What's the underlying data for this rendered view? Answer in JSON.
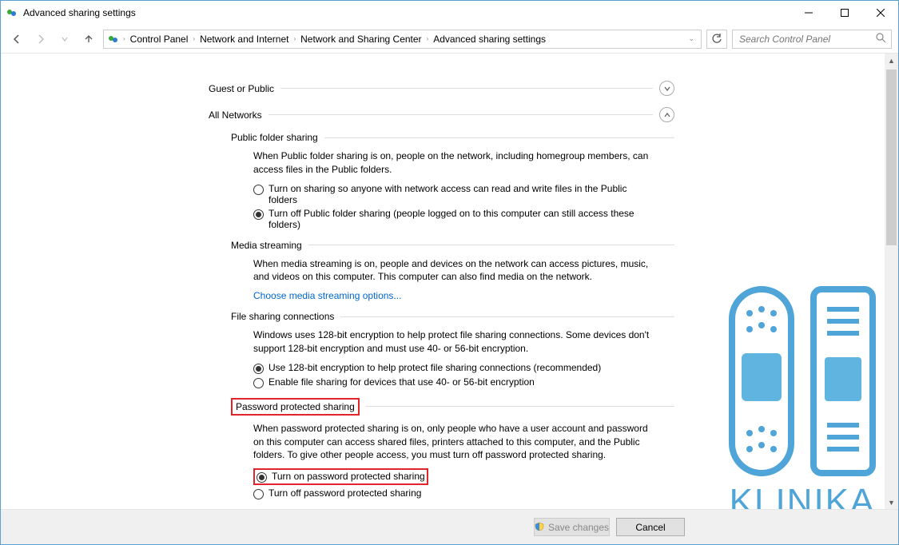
{
  "window": {
    "title": "Advanced sharing settings"
  },
  "breadcrumb": {
    "items": [
      "Control Panel",
      "Network and Internet",
      "Network and Sharing Center",
      "Advanced sharing settings"
    ]
  },
  "search": {
    "placeholder": "Search Control Panel"
  },
  "sections": {
    "guest": {
      "label": "Guest or Public"
    },
    "all": {
      "label": "All Networks"
    }
  },
  "public_folder": {
    "heading": "Public folder sharing",
    "desc": "When Public folder sharing is on, people on the network, including homegroup members, can access files in the Public folders.",
    "opt1": "Turn on sharing so anyone with network access can read and write files in the Public folders",
    "opt2": "Turn off Public folder sharing (people logged on to this computer can still access these folders)"
  },
  "media": {
    "heading": "Media streaming",
    "desc": "When media streaming is on, people and devices on the network can access pictures, music, and videos on this computer. This computer can also find media on the network.",
    "link": "Choose media streaming options..."
  },
  "file_conn": {
    "heading": "File sharing connections",
    "desc": "Windows uses 128-bit encryption to help protect file sharing connections. Some devices don't support 128-bit encryption and must use 40- or 56-bit encryption.",
    "opt1": "Use 128-bit encryption to help protect file sharing connections (recommended)",
    "opt2": "Enable file sharing for devices that use 40- or 56-bit encryption"
  },
  "password": {
    "heading": "Password protected sharing",
    "desc": "When password protected sharing is on, only people who have a user account and password on this computer can access shared files, printers attached to this computer, and the Public folders. To give other people access, you must turn off password protected sharing.",
    "opt1": "Turn on password protected sharing",
    "opt2": "Turn off password protected sharing"
  },
  "buttons": {
    "save": "Save changes",
    "cancel": "Cancel"
  },
  "watermark": {
    "text": "KLINIKA"
  }
}
